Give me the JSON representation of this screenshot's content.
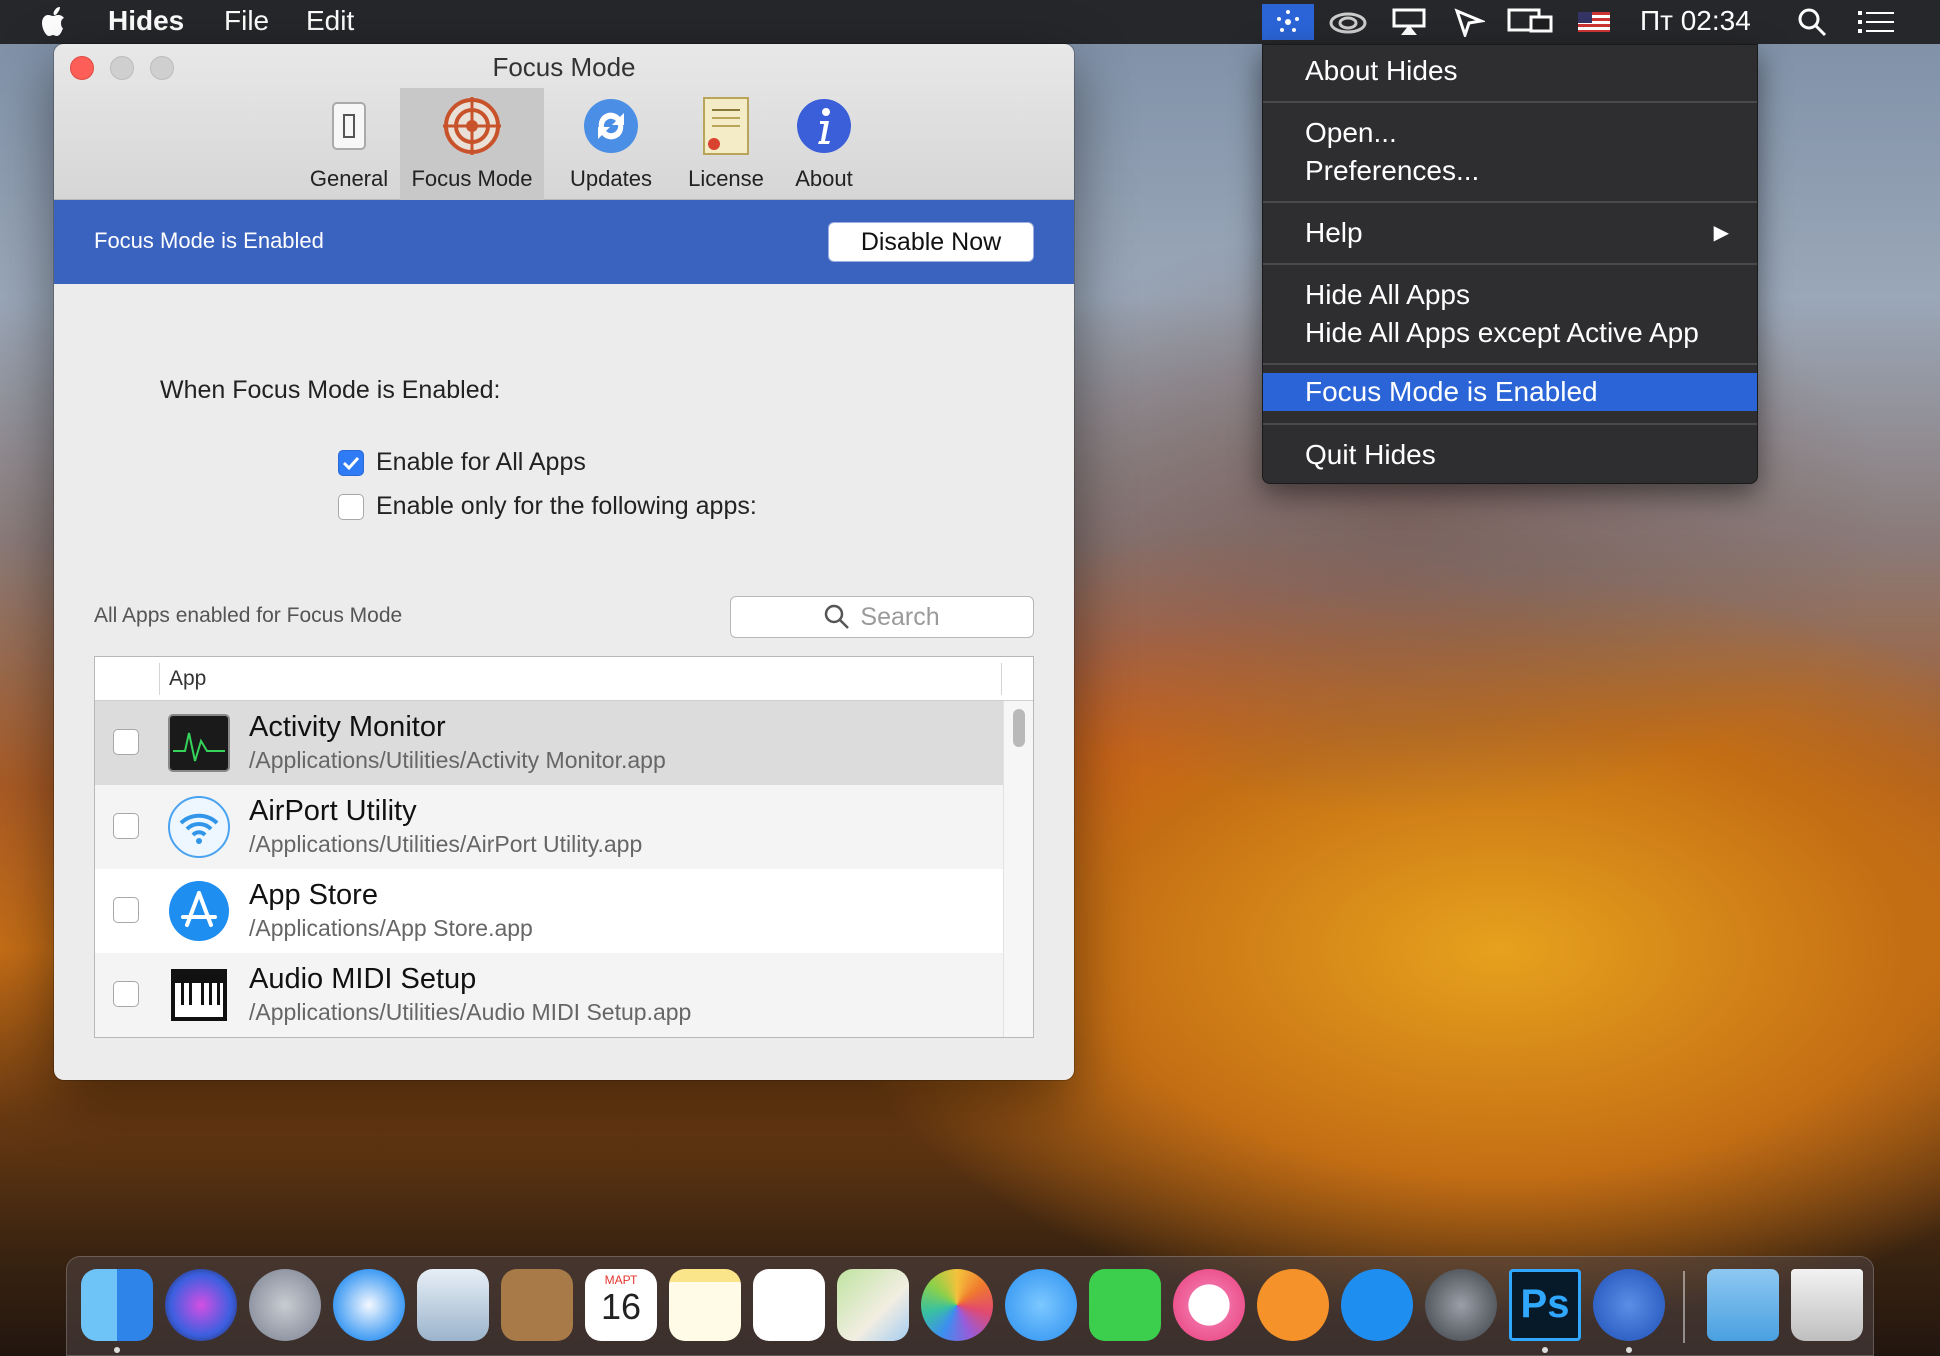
{
  "menubar": {
    "app_name": "Hides",
    "menus": [
      "File",
      "Edit"
    ],
    "clock": "Пт 02:34",
    "status_icons": [
      "hides-star-icon",
      "creative-cloud-icon",
      "airplay-icon",
      "pointer-icon",
      "display-icon",
      "us-flag-icon",
      "spotlight-icon",
      "notification-list-icon"
    ]
  },
  "dropdown": {
    "about": "About Hides",
    "open": "Open...",
    "preferences": "Preferences...",
    "help": "Help",
    "hide_all": "Hide All Apps",
    "hide_all_except": "Hide All Apps except Active App",
    "focus_mode": "Focus Mode is Enabled",
    "quit": "Quit Hides"
  },
  "window": {
    "title": "Focus Mode",
    "tabs": [
      {
        "label": "General",
        "icon": "switch-icon"
      },
      {
        "label": "Focus Mode",
        "icon": "target-icon"
      },
      {
        "label": "Updates",
        "icon": "refresh-icon"
      },
      {
        "label": "License",
        "icon": "certificate-icon"
      },
      {
        "label": "About",
        "icon": "info-icon"
      }
    ],
    "active_tab": "Focus Mode",
    "banner_text": "Focus Mode is Enabled",
    "disable_button": "Disable Now",
    "heading": "When Focus Mode is Enabled:",
    "options": [
      {
        "label": "Enable for All Apps",
        "checked": true
      },
      {
        "label": "Enable only for the following apps:",
        "checked": false
      }
    ],
    "list_caption": "All Apps enabled for Focus Mode",
    "search_placeholder": "Search",
    "column_header": "App",
    "apps": [
      {
        "name": "Activity Monitor",
        "path": "/Applications/Utilities/Activity Monitor.app",
        "checked": false,
        "icon": "activity-monitor-icon"
      },
      {
        "name": "AirPort Utility",
        "path": "/Applications/Utilities/AirPort Utility.app",
        "checked": false,
        "icon": "wifi-icon"
      },
      {
        "name": "App Store",
        "path": "/Applications/App Store.app",
        "checked": false,
        "icon": "app-store-icon"
      },
      {
        "name": "Audio MIDI Setup",
        "path": "/Applications/Utilities/Audio MIDI Setup.app",
        "checked": false,
        "icon": "piano-keys-icon"
      }
    ]
  },
  "dock": {
    "calendar_month": "МАРТ",
    "calendar_day": "16",
    "ps_label": "Ps",
    "icons": [
      "finder-icon",
      "siri-icon",
      "launchpad-icon",
      "safari-icon",
      "mail-icon",
      "contacts-icon",
      "calendar-icon",
      "notes-icon",
      "reminders-icon",
      "maps-icon",
      "photos-icon",
      "messages-icon",
      "facetime-icon",
      "itunes-icon",
      "ibooks-icon",
      "app-store-icon",
      "system-preferences-icon",
      "photoshop-icon",
      "hides-icon",
      "downloads-folder-icon",
      "trash-icon"
    ]
  },
  "colors": {
    "accent": "#2a64d6",
    "banner": "#3a62bf",
    "checkbox_checked": "#2f7af5"
  }
}
